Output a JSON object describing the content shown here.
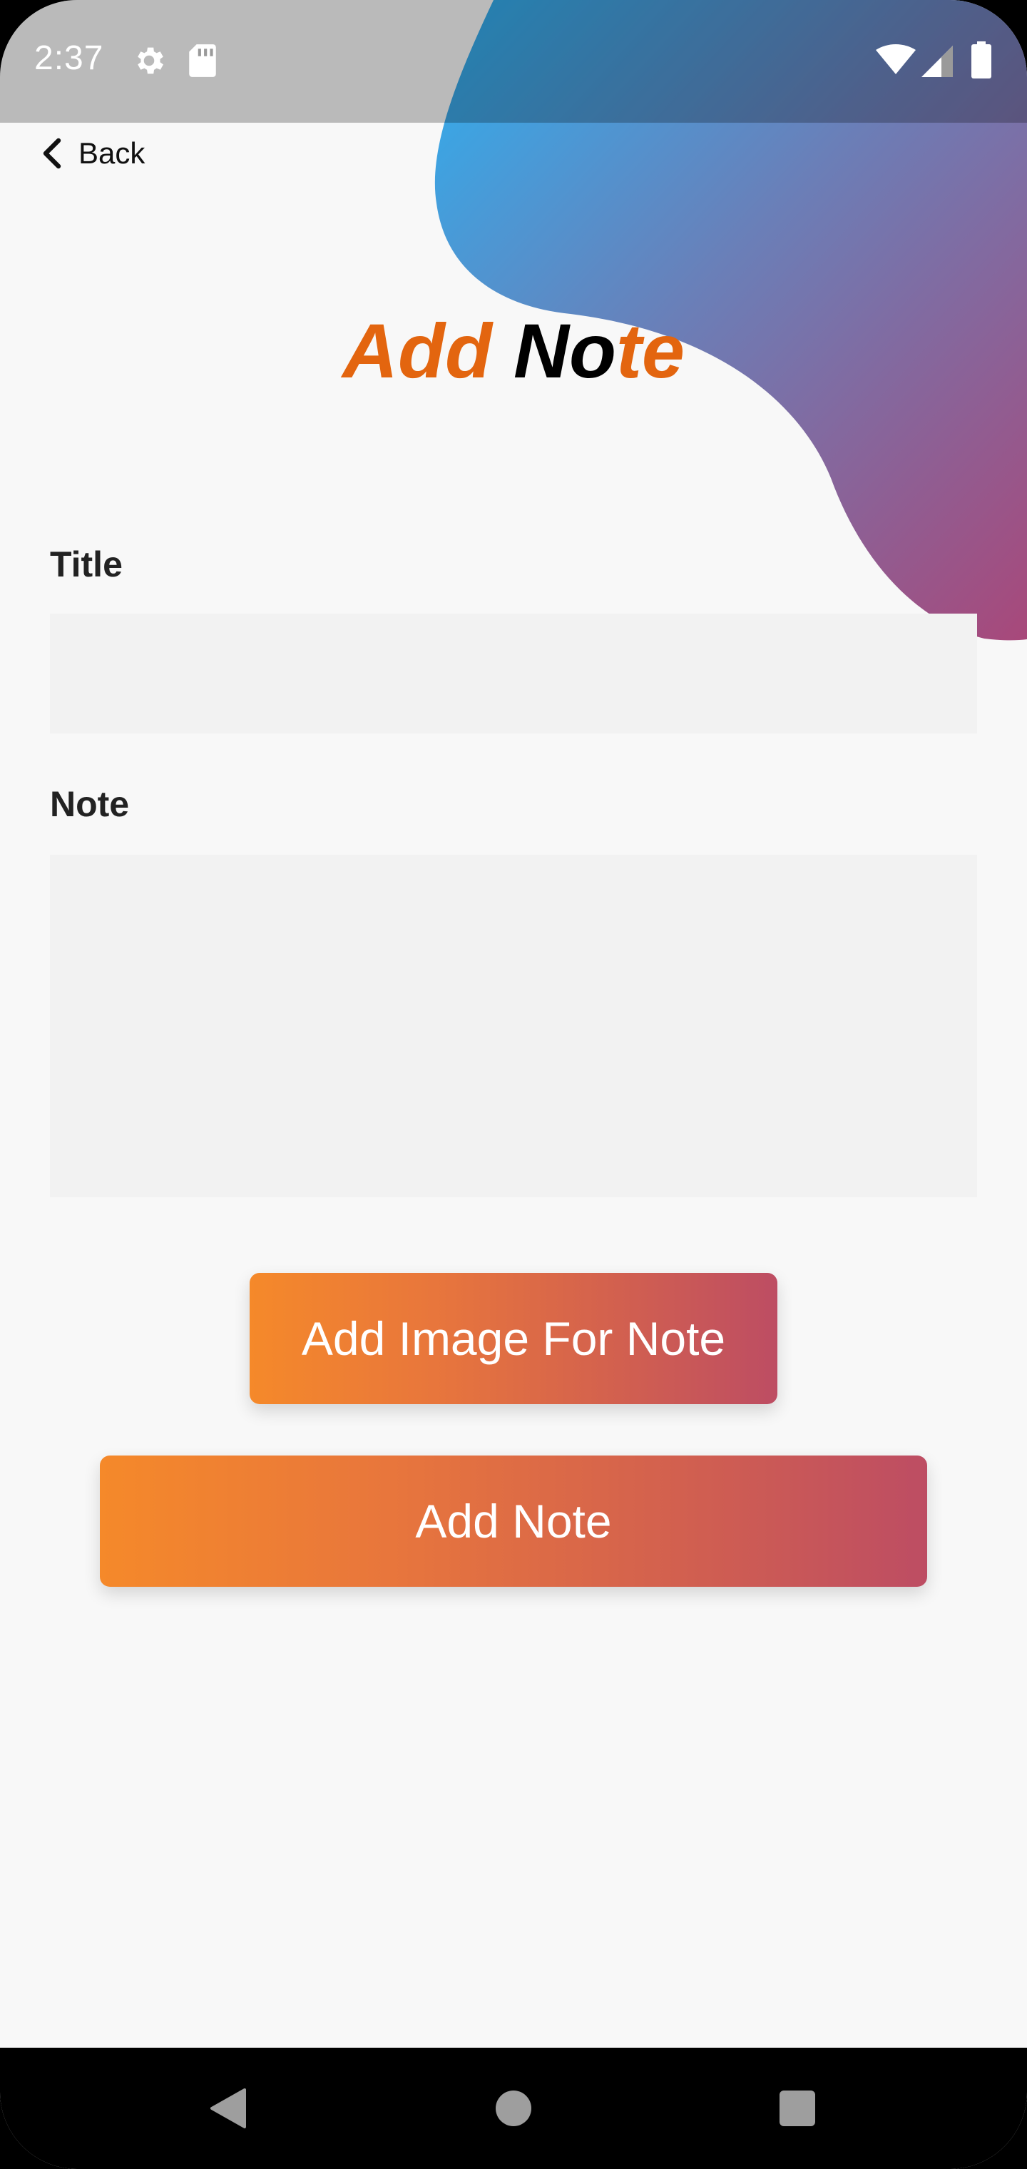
{
  "status_bar": {
    "time": "2:37",
    "icons": [
      "settings-gear-icon",
      "sd-card-icon",
      "wifi-icon",
      "cell-signal-icon",
      "battery-icon"
    ]
  },
  "header": {
    "back_label": "Back",
    "title_word_1": "Add",
    "title_word_2_part_a": "No",
    "title_word_2_part_b": "te"
  },
  "form": {
    "title_label": "Title",
    "title_value": "",
    "note_label": "Note",
    "note_value": ""
  },
  "buttons": {
    "add_image_label": "Add Image For Note",
    "add_note_label": "Add Note"
  },
  "nav_bar": {
    "icons": [
      "back-triangle-icon",
      "home-circle-icon",
      "recents-square-icon"
    ]
  },
  "colors": {
    "background": "#f8f8f8",
    "field_background": "#f2f2f2",
    "title_accent": "#e3650f",
    "button_gradient_start": "#f5892a",
    "button_gradient_end": "#bd4d63",
    "blob_gradient_start": "#2eb0f0",
    "blob_gradient_end": "#a8487a"
  }
}
